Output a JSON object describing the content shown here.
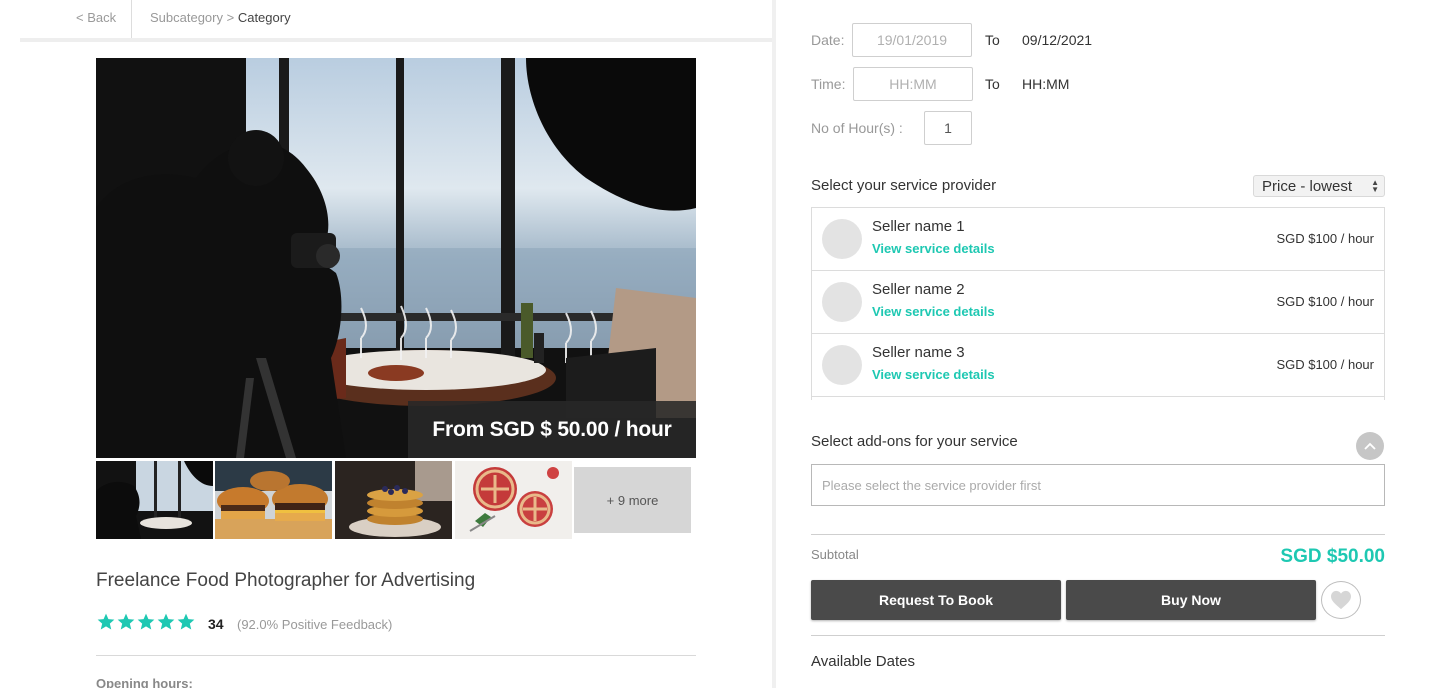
{
  "nav": {
    "back": "< Back",
    "subcategory": "Subcategory",
    "separator": " > ",
    "category": "Category"
  },
  "listing": {
    "price_badge": "From SGD $ 50.00 / hour",
    "more_photos": "+ 9 more",
    "title": "Freelance Food Photographer for Advertising",
    "rating_stars": 5,
    "review_count": "34",
    "feedback": "(92.0% Positive Feedback)",
    "opening_hours_label": "Opening hours:"
  },
  "booking": {
    "date_label": "Date:",
    "date_from": "19/01/2019",
    "to_label": "To",
    "date_to": "09/12/2021",
    "time_label": "Time:",
    "time_from_placeholder": "HH:MM",
    "time_to": "HH:MM",
    "hours_label": "No of Hour(s) :",
    "hours_value": "1"
  },
  "providers": {
    "title": "Select your service provider",
    "sort": "Price - lowest",
    "sellers": [
      {
        "name": "Seller name 1",
        "link": "View service details",
        "price": "SGD $100 / hour"
      },
      {
        "name": "Seller name 2",
        "link": "View service details",
        "price": "SGD $100 / hour"
      },
      {
        "name": "Seller name 3",
        "link": "View service details",
        "price": "SGD $100 / hour"
      }
    ]
  },
  "addons": {
    "title": "Select add-ons for your service",
    "placeholder": "Please select the service provider first"
  },
  "summary": {
    "subtotal_label": "Subtotal",
    "subtotal_value": "SGD $50.00",
    "request_button": "Request To Book",
    "buy_button": "Buy Now",
    "available_dates": "Available Dates"
  },
  "colors": {
    "accent": "#1ec8b2",
    "button_dark": "#4a4a4a"
  }
}
